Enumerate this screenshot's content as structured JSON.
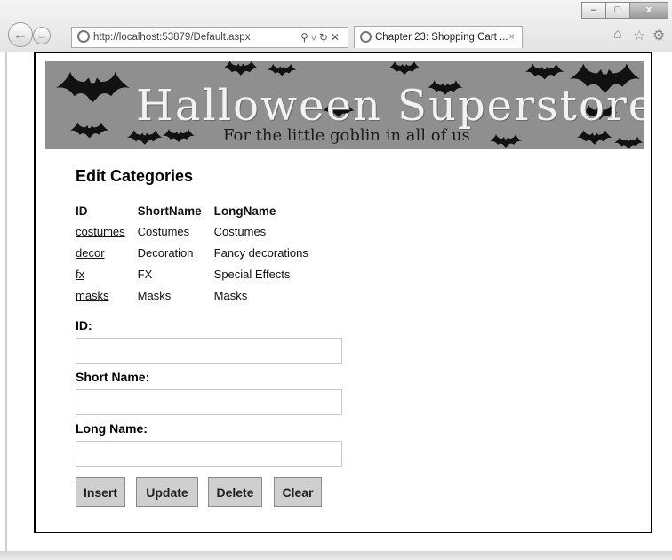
{
  "browser": {
    "url": "http://localhost:53879/Default.aspx",
    "tab_title": "Chapter 23: Shopping Cart ...",
    "tab_close": "×",
    "window_buttons": {
      "minimize": "–",
      "maximize": "□",
      "close": "x"
    },
    "icons": [
      "back-icon",
      "forward-icon",
      "ie-logo-icon",
      "search-icon",
      "compat-icon",
      "refresh-icon",
      "stop-icon",
      "home-icon",
      "favorites-icon",
      "settings-icon"
    ]
  },
  "banner": {
    "title": "Halloween Superstore",
    "tagline": "For the little goblin in all of us"
  },
  "page": {
    "heading": "Edit Categories",
    "table": {
      "headers": [
        "ID",
        "ShortName",
        "LongName"
      ],
      "rows": [
        [
          "costumes",
          "Costumes",
          "Costumes"
        ],
        [
          "decor",
          "Decoration",
          "Fancy decorations"
        ],
        [
          "fx",
          "FX",
          "Special Effects"
        ],
        [
          "masks",
          "Masks",
          "Masks"
        ]
      ]
    },
    "form": {
      "id_label": "ID:",
      "id_value": "",
      "short_label": "Short Name:",
      "short_value": "",
      "long_label": "Long Name:",
      "long_value": ""
    },
    "buttons": {
      "insert": "Insert",
      "update": "Update",
      "delete": "Delete",
      "clear": "Clear"
    }
  }
}
